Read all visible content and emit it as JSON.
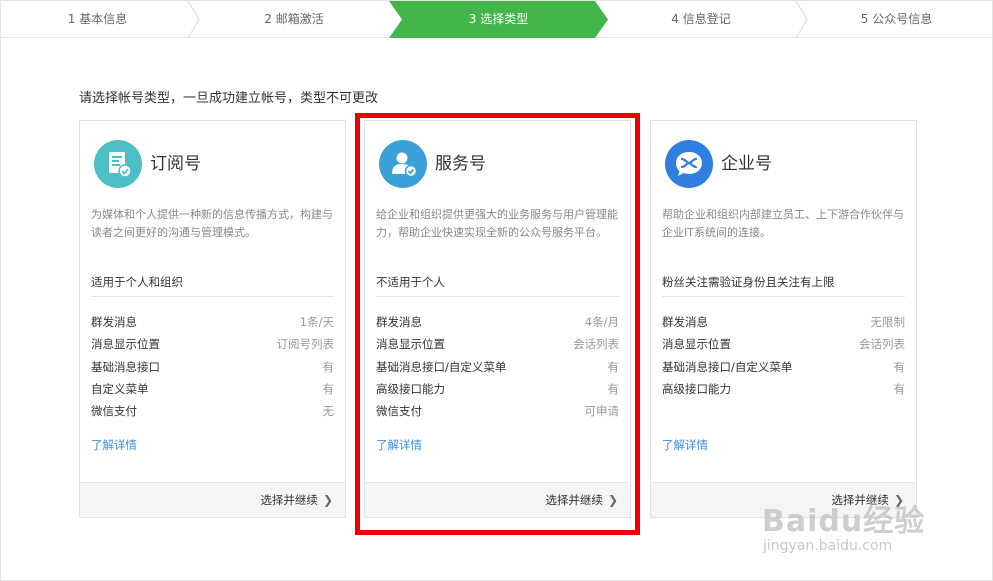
{
  "steps": [
    {
      "label": "1 基本信息",
      "state": "done"
    },
    {
      "label": "2 邮箱激活",
      "state": "done"
    },
    {
      "label": "3 选择类型",
      "state": "active"
    },
    {
      "label": "4 信息登记",
      "state": "todo"
    },
    {
      "label": "5 公众号信息",
      "state": "todo"
    }
  ],
  "instruction": "请选择帐号类型，一旦成功建立帐号，类型不可更改",
  "cards": [
    {
      "title": "订阅号",
      "icon": "document-check-icon",
      "icon_color": "#4bbfc5",
      "description": "为媒体和个人提供一种新的信息传播方式，构建与读者之间更好的沟通与管理模式。",
      "suitability": "适用于个人和组织",
      "features": [
        {
          "name": "群发消息",
          "value": "1条/天"
        },
        {
          "name": "消息显示位置",
          "value": "订阅号列表"
        },
        {
          "name": "基础消息接口",
          "value": "有"
        },
        {
          "name": "自定义菜单",
          "value": "有"
        },
        {
          "name": "微信支付",
          "value": "无"
        }
      ],
      "learn_more": "了解详情",
      "select_label": "选择并继续"
    },
    {
      "title": "服务号",
      "icon": "user-check-icon",
      "icon_color": "#3aa0d8",
      "description": "给企业和组织提供更强大的业务服务与用户管理能力，帮助企业快速实现全新的公众号服务平台。",
      "suitability": "不适用于个人",
      "features": [
        {
          "name": "群发消息",
          "value": "4条/月"
        },
        {
          "name": "消息显示位置",
          "value": "会话列表"
        },
        {
          "name": "基础消息接口/自定义菜单",
          "value": "有"
        },
        {
          "name": "高级接口能力",
          "value": "有"
        },
        {
          "name": "微信支付",
          "value": "可申请"
        }
      ],
      "learn_more": "了解详情",
      "select_label": "选择并继续"
    },
    {
      "title": "企业号",
      "icon": "enterprise-chat-icon",
      "icon_color": "#2f7ee0",
      "description": "帮助企业和组织内部建立员工、上下游合作伙伴与企业IT系统间的连接。",
      "suitability": "粉丝关注需验证身份且关注有上限",
      "features": [
        {
          "name": "群发消息",
          "value": "无限制"
        },
        {
          "name": "消息显示位置",
          "value": "会话列表"
        },
        {
          "name": "基础消息接口/自定义菜单",
          "value": "有"
        },
        {
          "name": "高级接口能力",
          "value": "有"
        }
      ],
      "learn_more": "了解详情",
      "select_label": "选择并继续"
    }
  ],
  "watermark": {
    "brand": "Baidu经验",
    "url": "jingyan.baidu.com"
  },
  "colors": {
    "active_step": "#44b549",
    "highlight_border": "#ec0000",
    "link": "#3a8ee6"
  }
}
